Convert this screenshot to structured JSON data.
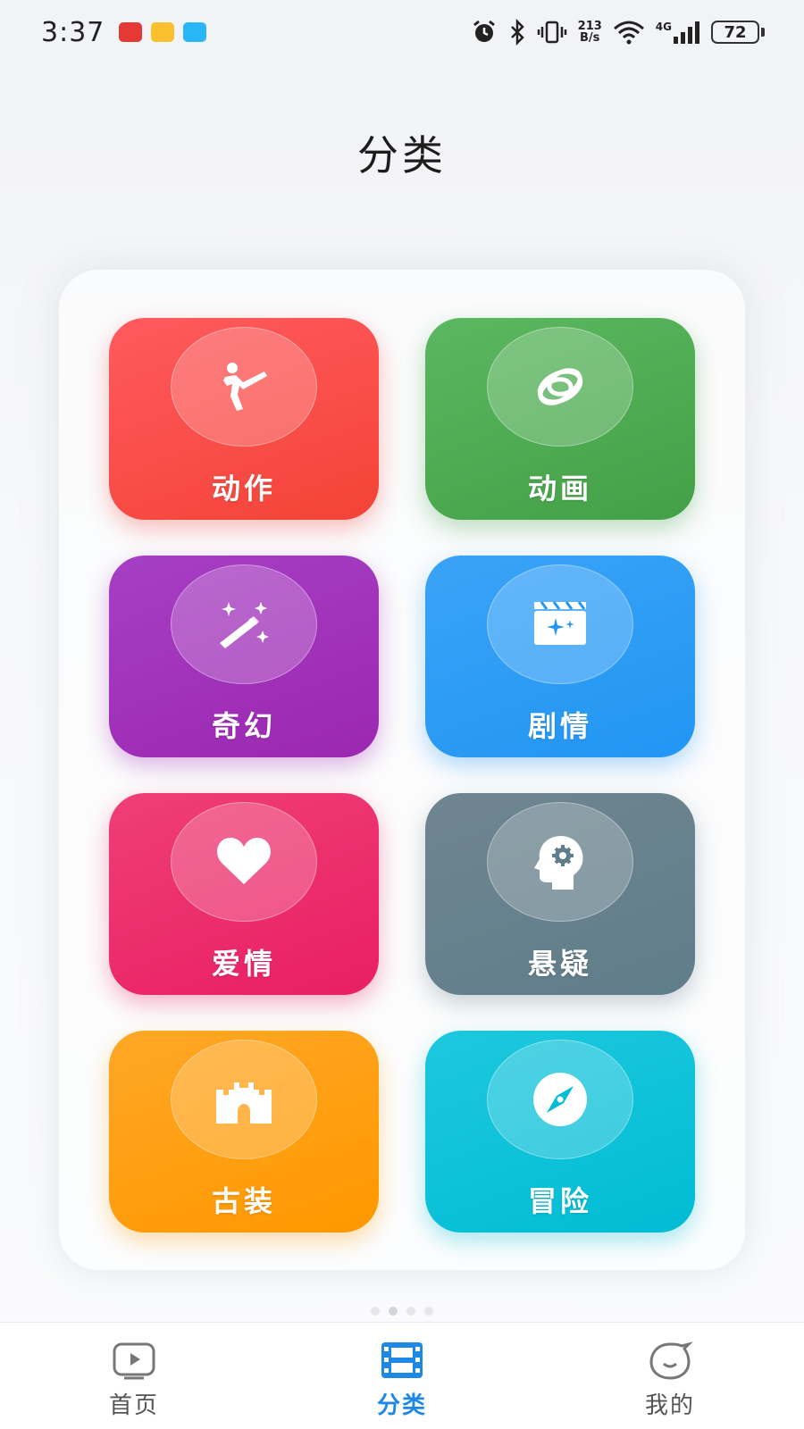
{
  "status_bar": {
    "time": "3:37",
    "net_speed_top": "213",
    "net_speed_bottom": "B/s",
    "network": "4G",
    "battery": "72"
  },
  "page": {
    "title": "分类"
  },
  "categories": [
    {
      "label": "动作",
      "icon": "martial-arts-kick-icon",
      "color_top": "#ff5a5f",
      "color_bottom": "#f44336"
    },
    {
      "label": "动画",
      "icon": "rings-icon",
      "color_top": "#5cb860",
      "color_bottom": "#43a047"
    },
    {
      "label": "奇幻",
      "icon": "magic-wand-icon",
      "color_top": "#a63fc4",
      "color_bottom": "#9c27b0"
    },
    {
      "label": "剧情",
      "icon": "clapperboard-icon",
      "color_top": "#3aa3f7",
      "color_bottom": "#2196f3"
    },
    {
      "label": "爱情",
      "icon": "heart-icon",
      "color_top": "#ef3f77",
      "color_bottom": "#e91e63"
    },
    {
      "label": "悬疑",
      "icon": "head-gear-icon",
      "color_top": "#6f8590",
      "color_bottom": "#607d8b"
    },
    {
      "label": "古装",
      "icon": "castle-icon",
      "color_top": "#ffa726",
      "color_bottom": "#ff9800"
    },
    {
      "label": "冒险",
      "icon": "compass-icon",
      "color_top": "#1ec8de",
      "color_bottom": "#00bcd4"
    }
  ],
  "bottom_nav": {
    "items": [
      {
        "label": "首页",
        "icon": "play-tv-icon",
        "active": false
      },
      {
        "label": "分类",
        "icon": "film-strip-icon",
        "active": true
      },
      {
        "label": "我的",
        "icon": "smiley-face-icon",
        "active": false
      }
    ],
    "active_color": "#1e88e5"
  }
}
